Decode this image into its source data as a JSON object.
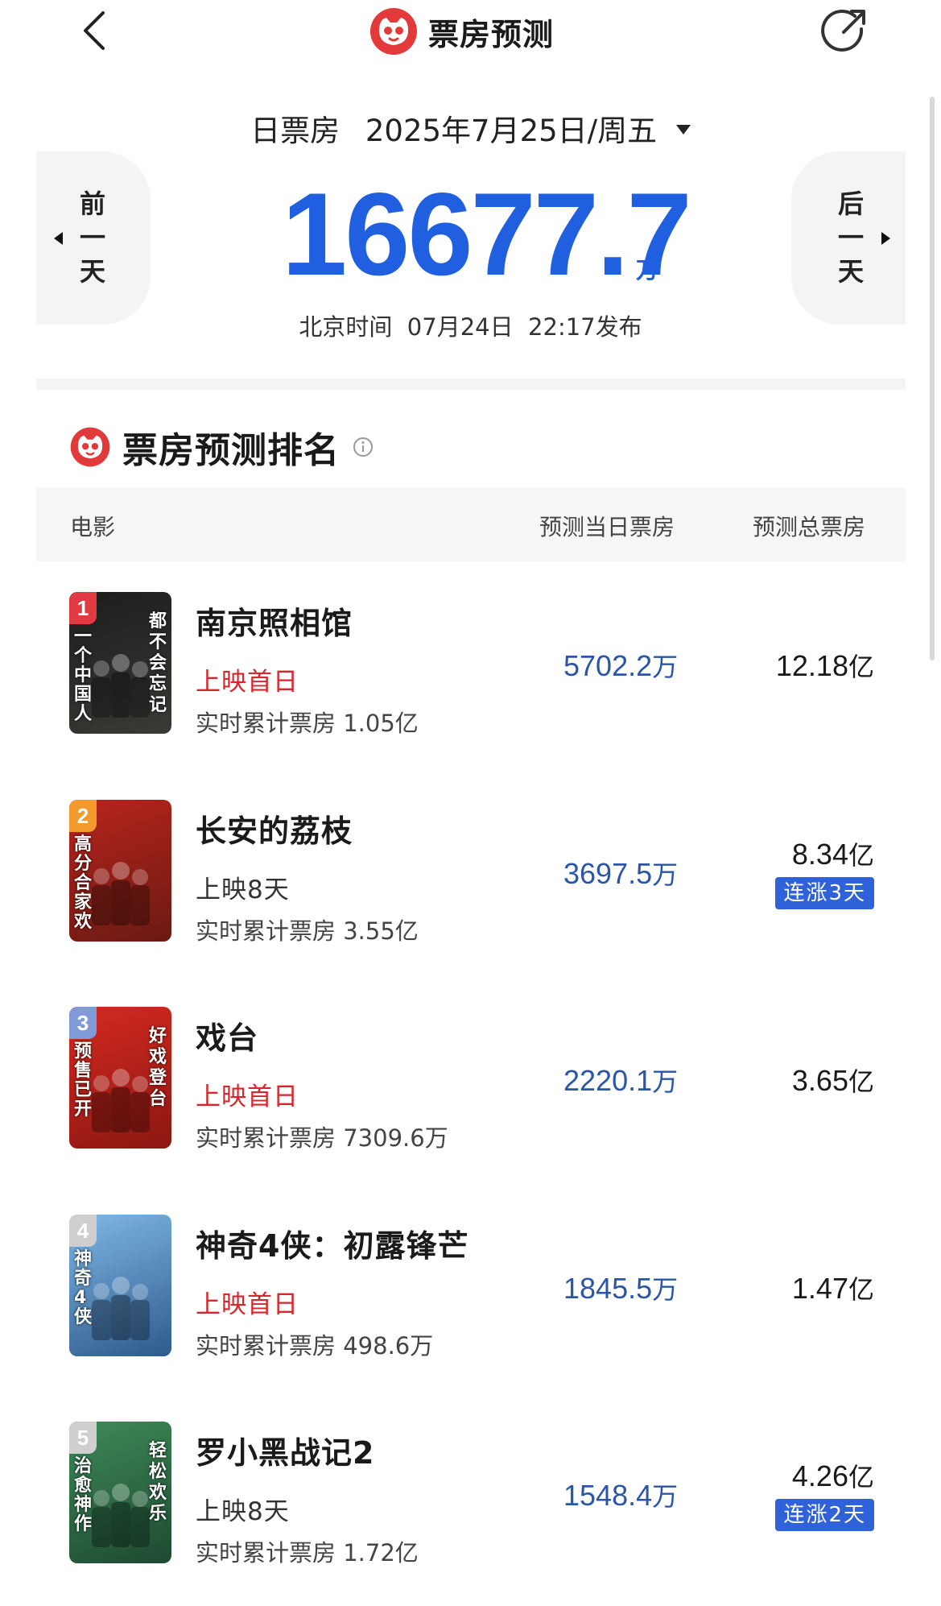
{
  "nav": {
    "title": "票房预测",
    "back_icon": "chevron-left-icon",
    "share_icon": "share-icon"
  },
  "date_selector": {
    "label": "日票房",
    "date": "2025年7月25日/周五"
  },
  "prev_day": "前一天",
  "next_day": "后一天",
  "total_forecast": {
    "value": "16677.7",
    "unit": "万",
    "publish_time": "北京时间  07月24日  22:17发布"
  },
  "ranking": {
    "title": "票房预测排名",
    "columns": {
      "movie": "电影",
      "day_forecast": "预测当日票房",
      "total_forecast": "预测总票房"
    },
    "movies": [
      {
        "rank": "1",
        "badge_color": "#e23a42",
        "title": "南京照相馆",
        "status": "上映首日",
        "status_first": true,
        "cumulative": "实时累计票房 1.05亿",
        "day_value": "5702.2",
        "day_unit": "万",
        "total_value": "12.18",
        "total_unit": "亿",
        "streak": "",
        "poster_colors": [
          "#1c1c1c",
          "#3a3a36"
        ],
        "poster_text_right": "都不会忘记",
        "poster_text_left": "一个中国人"
      },
      {
        "rank": "2",
        "badge_color": "#f29a2e",
        "title": "长安的荔枝",
        "status": "上映8天",
        "status_first": false,
        "cumulative": "实时累计票房 3.55亿",
        "day_value": "3697.5",
        "day_unit": "万",
        "total_value": "8.34",
        "total_unit": "亿",
        "streak": "连涨3天",
        "poster_colors": [
          "#b8241c",
          "#6a1a12"
        ],
        "poster_text_right": "",
        "poster_text_left": "高分合家欢"
      },
      {
        "rank": "3",
        "badge_color": "#7f9ad6",
        "title": "戏台",
        "status": "上映首日",
        "status_first": true,
        "cumulative": "实时累计票房 7309.6万",
        "day_value": "2220.1",
        "day_unit": "万",
        "total_value": "3.65",
        "total_unit": "亿",
        "streak": "",
        "poster_colors": [
          "#d42a20",
          "#8c1712"
        ],
        "poster_text_right": "好戏登台",
        "poster_text_left": "预售已开"
      },
      {
        "rank": "4",
        "badge_color": "#cfcfcf",
        "title": "神奇4侠：初露锋芒",
        "status": "上映首日",
        "status_first": true,
        "cumulative": "实时累计票房 498.6万",
        "day_value": "1845.5",
        "day_unit": "万",
        "total_value": "1.47",
        "total_unit": "亿",
        "streak": "",
        "poster_colors": [
          "#7fb8e6",
          "#2e5a8c"
        ],
        "poster_text_right": "",
        "poster_text_left": "神奇4侠"
      },
      {
        "rank": "5",
        "badge_color": "#cfcfcf",
        "title": "罗小黑战记2",
        "status": "上映8天",
        "status_first": false,
        "cumulative": "实时累计票房 1.72亿",
        "day_value": "1548.4",
        "day_unit": "万",
        "total_value": "4.26",
        "total_unit": "亿",
        "streak": "连涨2天",
        "poster_colors": [
          "#3e8a56",
          "#1e4a32"
        ],
        "poster_text_right": "轻松欢乐",
        "poster_text_left": "治愈神作"
      }
    ]
  }
}
